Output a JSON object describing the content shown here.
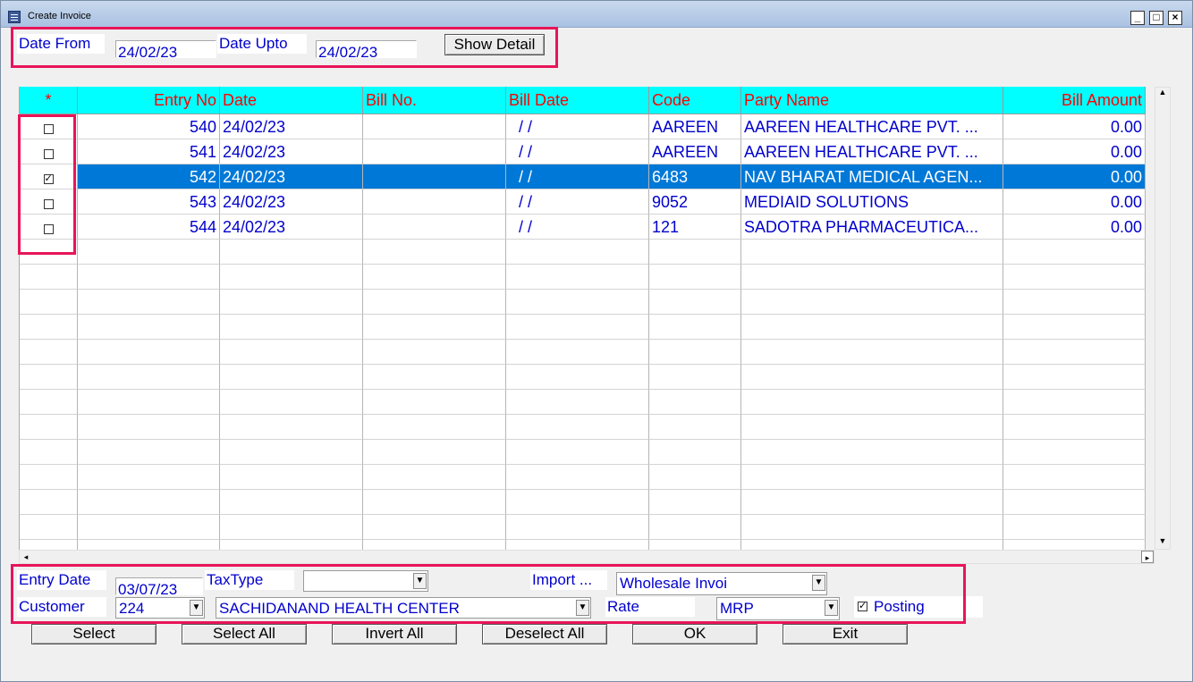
{
  "window": {
    "title": "Create Invoice",
    "minimize": "_",
    "maximize": "□",
    "close": "×"
  },
  "filter": {
    "date_from_label": "Date From",
    "date_from_value": "24/02/23",
    "date_upto_label": "Date Upto",
    "date_upto_value": "24/02/23",
    "show_detail_label": "Show Detail"
  },
  "grid": {
    "columns": [
      "*",
      "Entry No",
      "Date",
      "Bill No.",
      "Bill Date",
      "Code",
      "Party Name",
      "Bill Amount"
    ],
    "rows": [
      {
        "checked": false,
        "entry_no": "540",
        "date": "24/02/23",
        "bill_no": "",
        "bill_date": "/ /",
        "code": "AAREEN",
        "party": "AAREEN HEALTHCARE PVT. ...",
        "amount": "0.00"
      },
      {
        "checked": false,
        "entry_no": "541",
        "date": "24/02/23",
        "bill_no": "",
        "bill_date": "/ /",
        "code": "AAREEN",
        "party": "AAREEN HEALTHCARE PVT. ...",
        "amount": "0.00"
      },
      {
        "checked": true,
        "entry_no": "542",
        "date": "24/02/23",
        "bill_no": "",
        "bill_date": "/ /",
        "code": "6483",
        "party": "NAV BHARAT MEDICAL AGEN...",
        "amount": "0.00",
        "selected": true
      },
      {
        "checked": false,
        "entry_no": "543",
        "date": "24/02/23",
        "bill_no": "",
        "bill_date": "/ /",
        "code": "9052",
        "party": "MEDIAID SOLUTIONS",
        "amount": "0.00"
      },
      {
        "checked": false,
        "entry_no": "544",
        "date": "24/02/23",
        "bill_no": "",
        "bill_date": "/ /",
        "code": "121",
        "party": "SADOTRA PHARMACEUTICA...",
        "amount": "0.00"
      }
    ]
  },
  "form": {
    "entry_date_label": "Entry Date",
    "entry_date_value": "03/07/23",
    "taxtype_label": "TaxType",
    "taxtype_value": "",
    "import_label": "Import ...",
    "import_value": "Wholesale Invoi",
    "customer_label": "Customer",
    "customer_code": "224",
    "customer_name": "SACHIDANAND HEALTH CENTER",
    "rate_label": "Rate",
    "rate_value": "MRP",
    "posting_label": "Posting",
    "posting_checked": true
  },
  "buttons": {
    "select": "Select",
    "select_all": "Select All",
    "invert_all": "Invert All",
    "deselect_all": "Deselect All",
    "ok": "OK",
    "exit": "Exit"
  },
  "colors": {
    "header_bg": "#00ffff",
    "header_text": "#ff0000",
    "cell_text": "#0000cc",
    "selection": "#0078d7",
    "highlight_box": "#e8155a"
  }
}
